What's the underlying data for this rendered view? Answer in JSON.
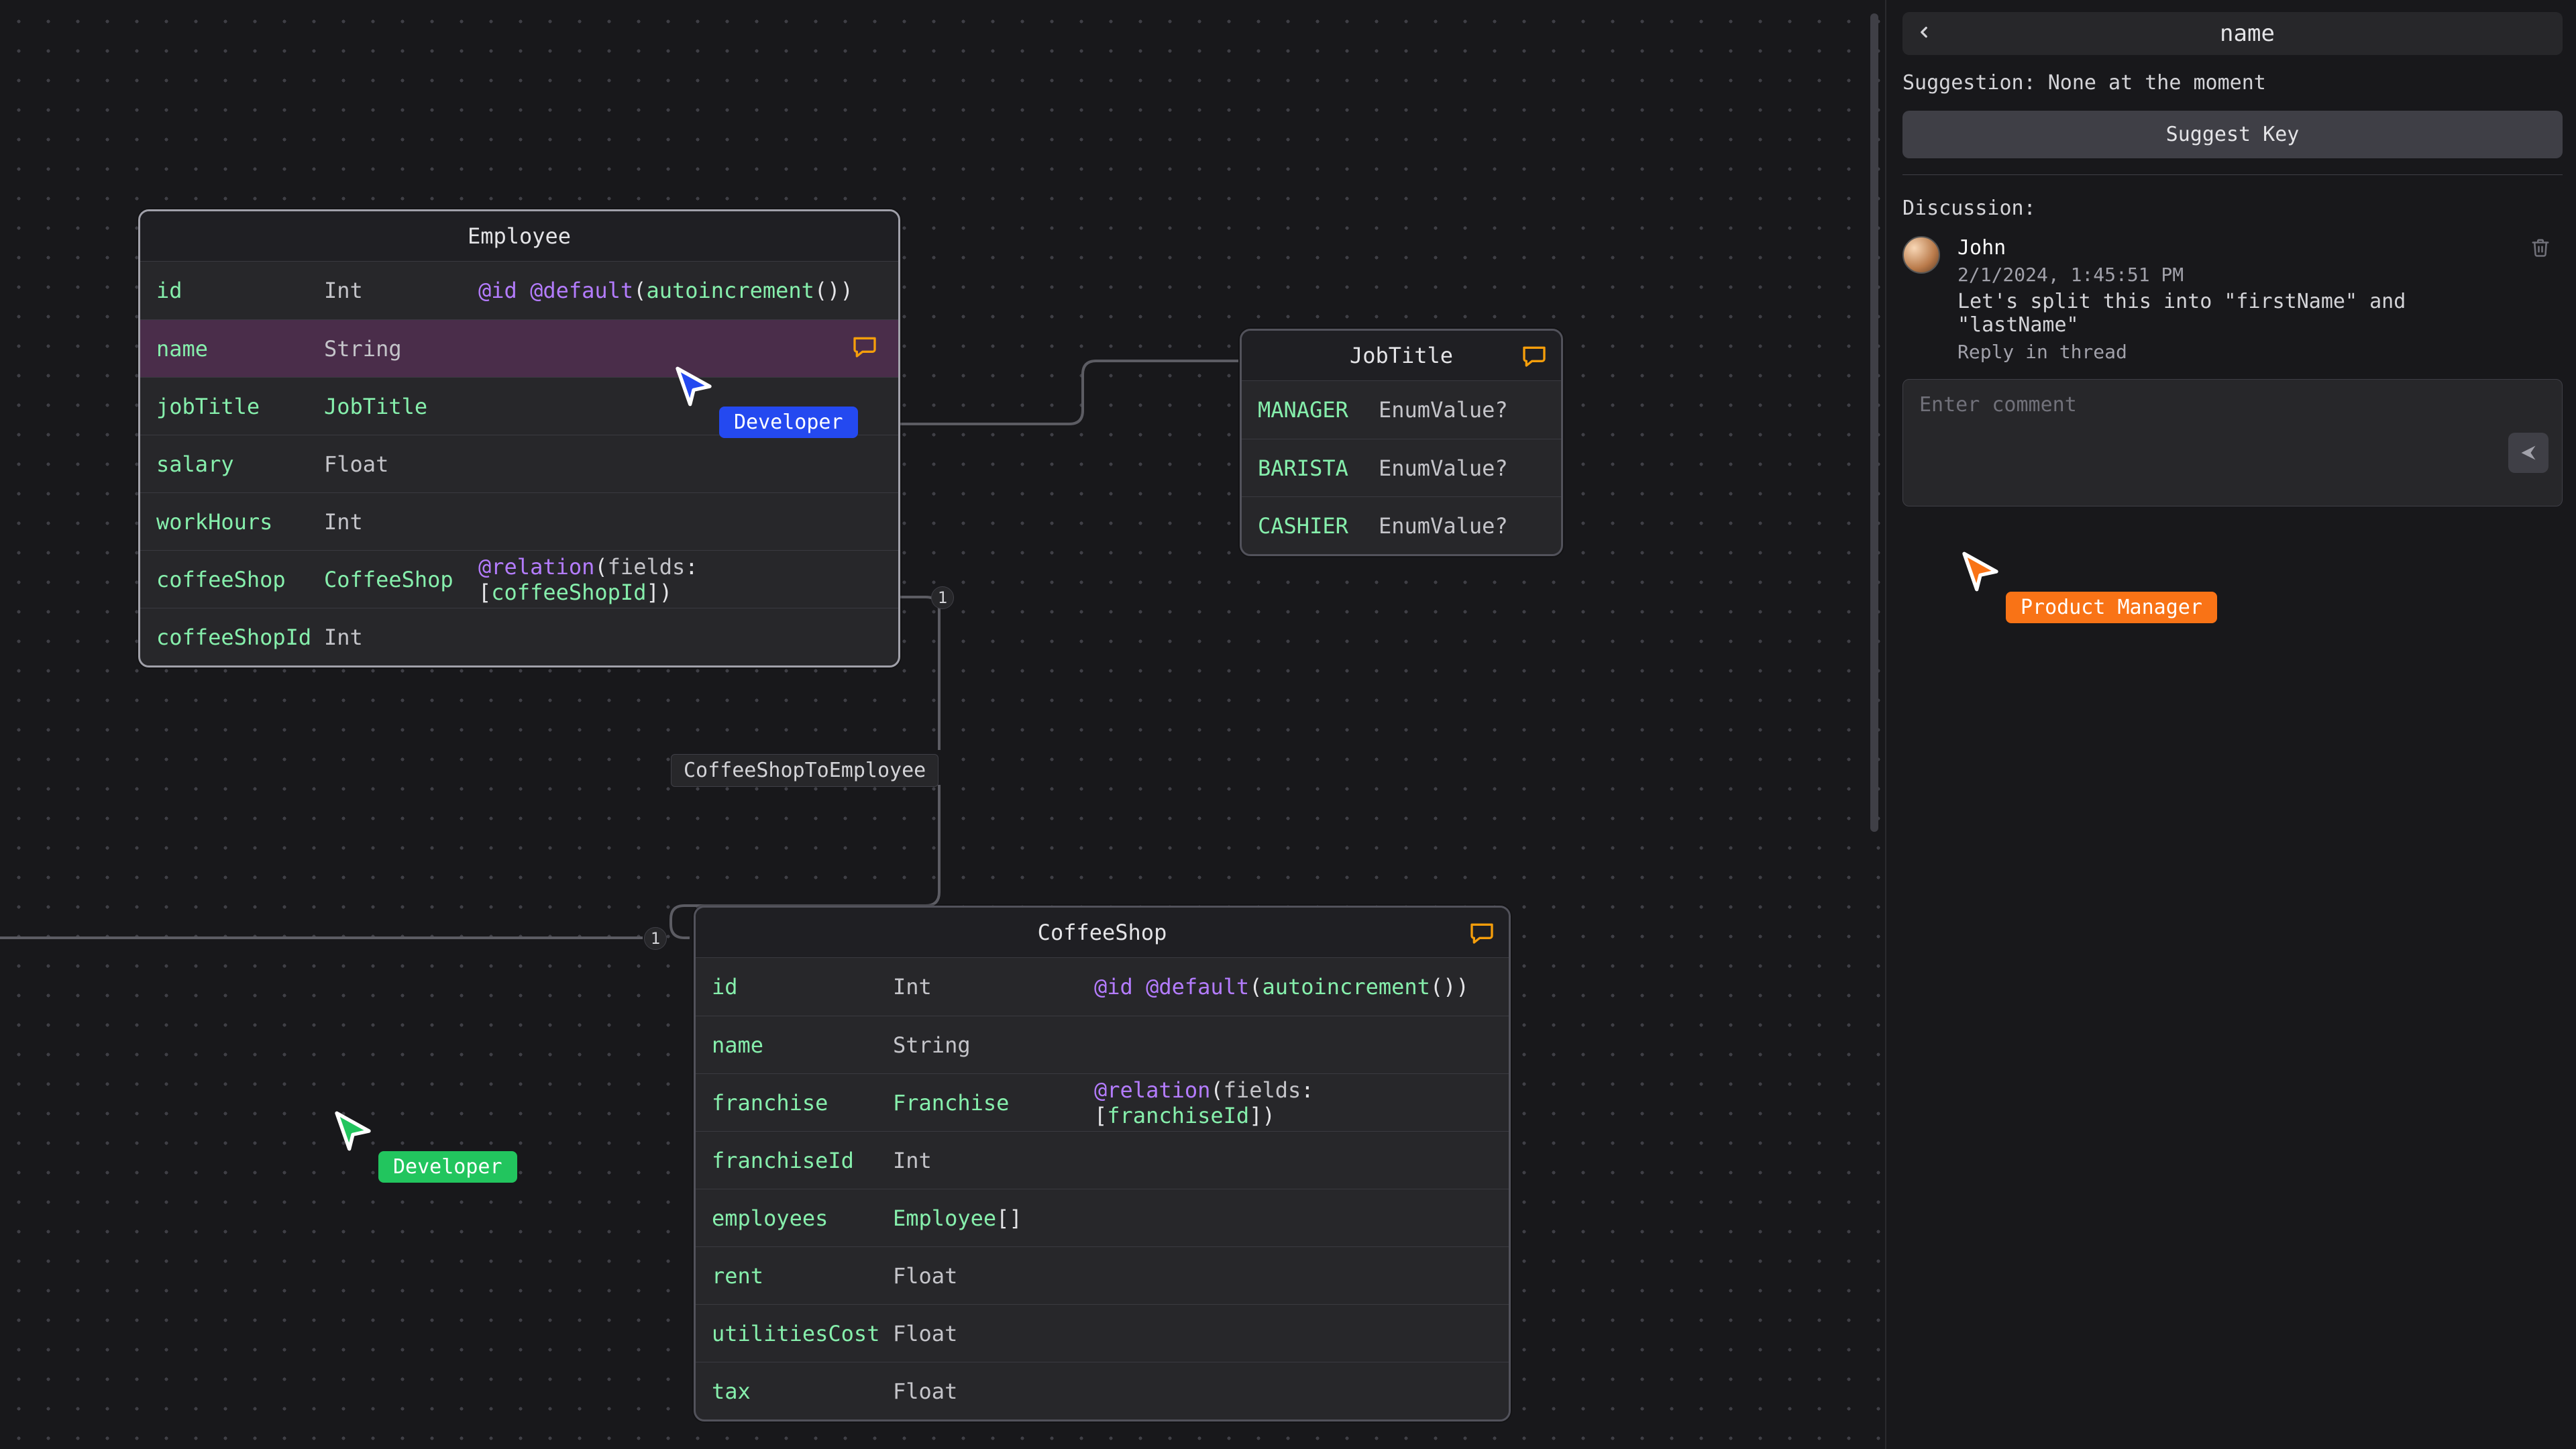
{
  "panel": {
    "title": "name",
    "suggestion_prefix": "Suggestion: ",
    "suggestion_value": "None at the moment",
    "suggest_btn": "Suggest Key",
    "discussion_title": "Discussion:",
    "comment_input_placeholder": "Enter comment",
    "comments": [
      {
        "author": "John",
        "timestamp": "2/1/2024, 1:45:51 PM",
        "text": "Let's split this into \"firstName\" and \"lastName\"",
        "reply_label": "Reply in thread"
      }
    ]
  },
  "cursors": {
    "blue": {
      "label": "Developer"
    },
    "green": {
      "label": "Developer"
    },
    "orange": {
      "label": "Product Manager"
    }
  },
  "edges": {
    "coffeeShopEmployee_label": "CoffeeShopToEmployee",
    "card_one_a": "1",
    "card_one_b": "1"
  },
  "models": {
    "employee": {
      "title": "Employee",
      "fields": [
        {
          "name": "id",
          "type": "Int",
          "at1": "@id",
          "at2": "@default",
          "paren_l": "(",
          "auto": "autoincrement",
          "paren_auto": "()",
          "paren_r": ")"
        },
        {
          "name": "name",
          "type": "String"
        },
        {
          "name": "jobTitle",
          "type": "JobTitle"
        },
        {
          "name": "salary",
          "type": "Float"
        },
        {
          "name": "workHours",
          "type": "Int"
        },
        {
          "name": "coffeeShop",
          "type": "CoffeeShop",
          "rel": "@relation",
          "rel_l": "(",
          "rel_key": "fields",
          "rel_colon": ":",
          "rel_bl": "[",
          "rel_ref": "coffeeShopId",
          "rel_br": "]",
          "rel_r": ")"
        },
        {
          "name": "coffeeShopId",
          "type": "Int"
        }
      ]
    },
    "jobTitle": {
      "title": "JobTitle",
      "fields": [
        {
          "name": "MANAGER",
          "type": "EnumValue?"
        },
        {
          "name": "BARISTA",
          "type": "EnumValue?"
        },
        {
          "name": "CASHIER",
          "type": "EnumValue?"
        }
      ]
    },
    "coffeeShop": {
      "title": "CoffeeShop",
      "fields": [
        {
          "name": "id",
          "type": "Int",
          "at1": "@id",
          "at2": "@default",
          "paren_l": "(",
          "auto": "autoincrement",
          "paren_auto": "()",
          "paren_r": ")"
        },
        {
          "name": "name",
          "type": "String"
        },
        {
          "name": "franchise",
          "type": "Franchise",
          "rel": "@relation",
          "rel_l": "(",
          "rel_key": "fields",
          "rel_colon": ":",
          "rel_bl": "[",
          "rel_ref": "franchiseId",
          "rel_br": "]",
          "rel_r": ")"
        },
        {
          "name": "franchiseId",
          "type": "Int"
        },
        {
          "name": "employees",
          "type": "Employee",
          "suffix": "[]"
        },
        {
          "name": "rent",
          "type": "Float"
        },
        {
          "name": "utilitiesCost",
          "type": "Float"
        },
        {
          "name": "tax",
          "type": "Float"
        }
      ]
    }
  }
}
